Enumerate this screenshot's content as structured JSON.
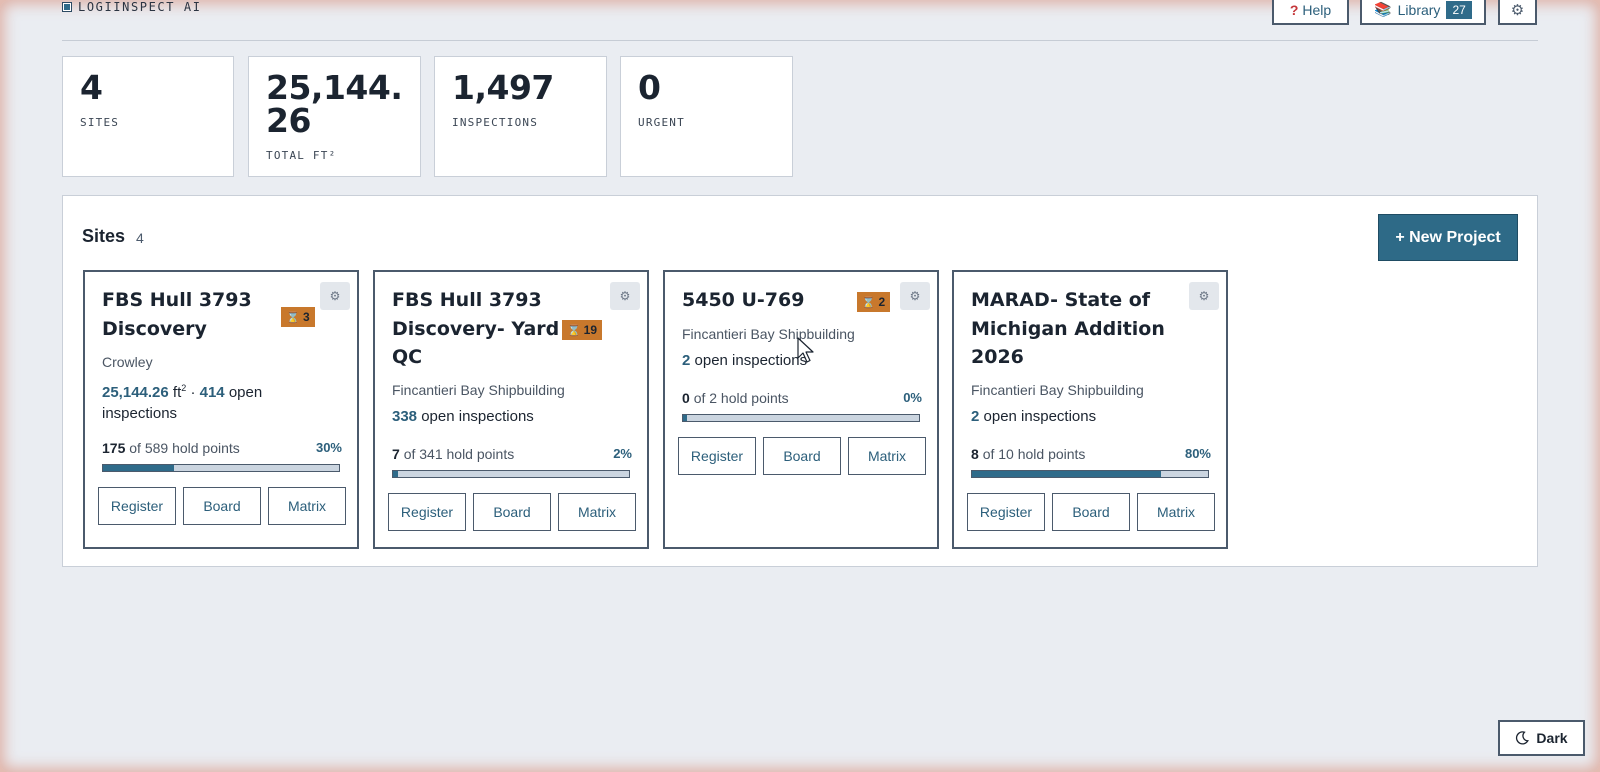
{
  "app": {
    "brand": "LOGIINSPECT AI"
  },
  "header": {
    "help_label": "Help",
    "library_label": "Library",
    "library_count": "27",
    "settings_icon": "gear-icon"
  },
  "stats": [
    {
      "value": "4",
      "label": "SITES"
    },
    {
      "value_line1": "25,144.",
      "value_line2": "26",
      "label": "TOTAL FT²"
    },
    {
      "value": "1,497",
      "label": "INSPECTIONS"
    },
    {
      "value": "0",
      "label": "URGENT"
    }
  ],
  "sites_panel": {
    "title": "Sites",
    "count": "4",
    "new_project_label": "+ New Project"
  },
  "cards": [
    {
      "title_lines": [
        "FBS Hull 3793",
        "Discovery"
      ],
      "badge": "3",
      "company": "Crowley",
      "area": "25,144.26",
      "area_unit": "ft",
      "area_sup": "2",
      "separator": "·",
      "open_count": "414",
      "open_text": "open",
      "open_text2": "inspections",
      "hold_done": "175",
      "hold_text": "of 589 hold points",
      "pct": "30%",
      "progress": 0.3
    },
    {
      "title_lines": [
        "FBS Hull 3793",
        "Discovery- Yard",
        "QC"
      ],
      "badge": "19",
      "company": "Fincantieri Bay Shipbuilding",
      "open_count": "338",
      "open_text": "open inspections",
      "hold_done": "7",
      "hold_text": "of 341 hold points",
      "pct": "2%",
      "progress": 0.02
    },
    {
      "title_lines": [
        "5450 U-769"
      ],
      "badge": "2",
      "company": "Fincantieri Bay Shipbuilding",
      "open_count": "2",
      "open_text": "open inspections",
      "hold_done": "0",
      "hold_text": "of 2 hold points",
      "pct": "0%",
      "progress": 0.0
    },
    {
      "title_lines": [
        "MARAD- State of",
        "Michigan Addition",
        "2026"
      ],
      "company": "Fincantieri Bay Shipbuilding",
      "open_count": "2",
      "open_text": "open inspections",
      "hold_done": "8",
      "hold_text": "of 10 hold points",
      "pct": "80%",
      "progress": 0.8
    }
  ],
  "card_actions": {
    "register": "Register",
    "board": "Board",
    "matrix": "Matrix"
  },
  "footer": {
    "theme_label": "Dark"
  },
  "colors": {
    "accent": "#2f6b8a",
    "badge": "#c8782c",
    "background": "#eaedf2"
  }
}
